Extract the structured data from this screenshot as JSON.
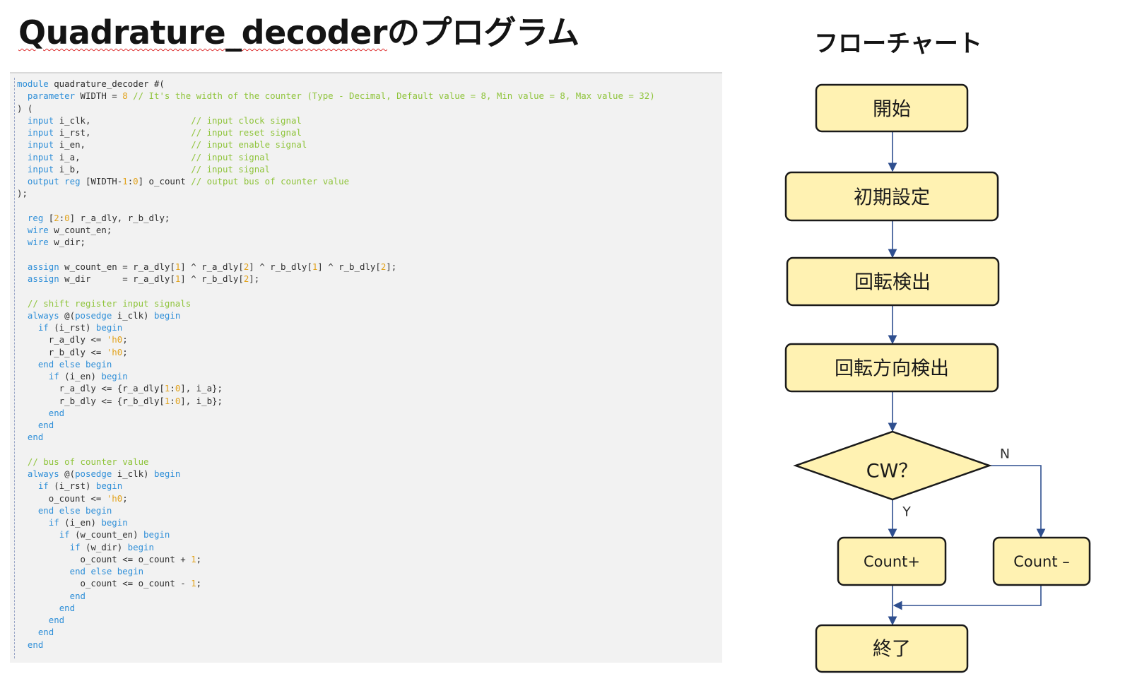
{
  "slide": {
    "title_main": "Quadrature_decoder",
    "title_suffix": "のプログラム"
  },
  "colors": {
    "keyword": "#2f8fd8",
    "comment": "#8fc43b",
    "number": "#e2a21a",
    "code_bg": "#f2f2f2",
    "node_fill": "#fff2b2",
    "node_stroke": "#1a1a1a",
    "edge": "#2f4f8f"
  },
  "code": {
    "language": "Verilog",
    "lines": [
      [
        [
          "kw",
          "module"
        ],
        [
          "id",
          " quadrature_decoder #("
        ]
      ],
      [
        [
          "id",
          "  "
        ],
        [
          "kw",
          "parameter"
        ],
        [
          "id",
          " WIDTH = "
        ],
        [
          "num",
          "8"
        ],
        [
          "id",
          " "
        ],
        [
          "cm",
          "// It's the width of the counter (Type - Decimal, Default value = 8, Min value = 8, Max value = 32)"
        ]
      ],
      [
        [
          "id",
          ") ("
        ]
      ],
      [
        [
          "id",
          "  "
        ],
        [
          "kw",
          "input"
        ],
        [
          "id",
          " i_clk,                   "
        ],
        [
          "cm",
          "// input clock signal"
        ]
      ],
      [
        [
          "id",
          "  "
        ],
        [
          "kw",
          "input"
        ],
        [
          "id",
          " i_rst,                   "
        ],
        [
          "cm",
          "// input reset signal"
        ]
      ],
      [
        [
          "id",
          "  "
        ],
        [
          "kw",
          "input"
        ],
        [
          "id",
          " i_en,                    "
        ],
        [
          "cm",
          "// input enable signal"
        ]
      ],
      [
        [
          "id",
          "  "
        ],
        [
          "kw",
          "input"
        ],
        [
          "id",
          " i_a,                     "
        ],
        [
          "cm",
          "// input signal"
        ]
      ],
      [
        [
          "id",
          "  "
        ],
        [
          "kw",
          "input"
        ],
        [
          "id",
          " i_b,                     "
        ],
        [
          "cm",
          "// input signal"
        ]
      ],
      [
        [
          "id",
          "  "
        ],
        [
          "kw",
          "output"
        ],
        [
          "id",
          " "
        ],
        [
          "kw",
          "reg"
        ],
        [
          "id",
          " [WIDTH-"
        ],
        [
          "num",
          "1"
        ],
        [
          "id",
          ":"
        ],
        [
          "num",
          "0"
        ],
        [
          "id",
          "] o_count "
        ],
        [
          "cm",
          "// output bus of counter value"
        ]
      ],
      [
        [
          "id",
          ");"
        ]
      ],
      [
        [
          "id",
          ""
        ]
      ],
      [
        [
          "id",
          "  "
        ],
        [
          "kw",
          "reg"
        ],
        [
          "id",
          " ["
        ],
        [
          "num",
          "2"
        ],
        [
          "id",
          ":"
        ],
        [
          "num",
          "0"
        ],
        [
          "id",
          "] r_a_dly, r_b_dly;"
        ]
      ],
      [
        [
          "id",
          "  "
        ],
        [
          "kw",
          "wire"
        ],
        [
          "id",
          " w_count_en;"
        ]
      ],
      [
        [
          "id",
          "  "
        ],
        [
          "kw",
          "wire"
        ],
        [
          "id",
          " w_dir;"
        ]
      ],
      [
        [
          "id",
          ""
        ]
      ],
      [
        [
          "id",
          "  "
        ],
        [
          "kw",
          "assign"
        ],
        [
          "id",
          " w_count_en = r_a_dly["
        ],
        [
          "num",
          "1"
        ],
        [
          "id",
          "] ^ r_a_dly["
        ],
        [
          "num",
          "2"
        ],
        [
          "id",
          "] ^ r_b_dly["
        ],
        [
          "num",
          "1"
        ],
        [
          "id",
          "] ^ r_b_dly["
        ],
        [
          "num",
          "2"
        ],
        [
          "id",
          "];"
        ]
      ],
      [
        [
          "id",
          "  "
        ],
        [
          "kw",
          "assign"
        ],
        [
          "id",
          " w_dir      = r_a_dly["
        ],
        [
          "num",
          "1"
        ],
        [
          "id",
          "] ^ r_b_dly["
        ],
        [
          "num",
          "2"
        ],
        [
          "id",
          "];"
        ]
      ],
      [
        [
          "id",
          ""
        ]
      ],
      [
        [
          "id",
          "  "
        ],
        [
          "cm",
          "// shift register input signals"
        ]
      ],
      [
        [
          "id",
          "  "
        ],
        [
          "kw",
          "always"
        ],
        [
          "id",
          " @("
        ],
        [
          "kw",
          "posedge"
        ],
        [
          "id",
          " i_clk) "
        ],
        [
          "kw",
          "begin"
        ]
      ],
      [
        [
          "id",
          "    "
        ],
        [
          "kw",
          "if"
        ],
        [
          "id",
          " (i_rst) "
        ],
        [
          "kw",
          "begin"
        ]
      ],
      [
        [
          "id",
          "      r_a_dly <= "
        ],
        [
          "str",
          "'h0"
        ],
        [
          "id",
          ";"
        ]
      ],
      [
        [
          "id",
          "      r_b_dly <= "
        ],
        [
          "str",
          "'h0"
        ],
        [
          "id",
          ";"
        ]
      ],
      [
        [
          "id",
          "    "
        ],
        [
          "kw",
          "end"
        ],
        [
          "id",
          " "
        ],
        [
          "kw",
          "else"
        ],
        [
          "id",
          " "
        ],
        [
          "kw",
          "begin"
        ]
      ],
      [
        [
          "id",
          "      "
        ],
        [
          "kw",
          "if"
        ],
        [
          "id",
          " (i_en) "
        ],
        [
          "kw",
          "begin"
        ]
      ],
      [
        [
          "id",
          "        r_a_dly <= {r_a_dly["
        ],
        [
          "num",
          "1"
        ],
        [
          "id",
          ":"
        ],
        [
          "num",
          "0"
        ],
        [
          "id",
          "], i_a};"
        ]
      ],
      [
        [
          "id",
          "        r_b_dly <= {r_b_dly["
        ],
        [
          "num",
          "1"
        ],
        [
          "id",
          ":"
        ],
        [
          "num",
          "0"
        ],
        [
          "id",
          "], i_b};"
        ]
      ],
      [
        [
          "id",
          "      "
        ],
        [
          "kw",
          "end"
        ]
      ],
      [
        [
          "id",
          "    "
        ],
        [
          "kw",
          "end"
        ]
      ],
      [
        [
          "id",
          "  "
        ],
        [
          "kw",
          "end"
        ]
      ],
      [
        [
          "id",
          ""
        ]
      ],
      [
        [
          "id",
          "  "
        ],
        [
          "cm",
          "// bus of counter value"
        ]
      ],
      [
        [
          "id",
          "  "
        ],
        [
          "kw",
          "always"
        ],
        [
          "id",
          " @("
        ],
        [
          "kw",
          "posedge"
        ],
        [
          "id",
          " i_clk) "
        ],
        [
          "kw",
          "begin"
        ]
      ],
      [
        [
          "id",
          "    "
        ],
        [
          "kw",
          "if"
        ],
        [
          "id",
          " (i_rst) "
        ],
        [
          "kw",
          "begin"
        ]
      ],
      [
        [
          "id",
          "      o_count <= "
        ],
        [
          "str",
          "'h0"
        ],
        [
          "id",
          ";"
        ]
      ],
      [
        [
          "id",
          "    "
        ],
        [
          "kw",
          "end"
        ],
        [
          "id",
          " "
        ],
        [
          "kw",
          "else"
        ],
        [
          "id",
          " "
        ],
        [
          "kw",
          "begin"
        ]
      ],
      [
        [
          "id",
          "      "
        ],
        [
          "kw",
          "if"
        ],
        [
          "id",
          " (i_en) "
        ],
        [
          "kw",
          "begin"
        ]
      ],
      [
        [
          "id",
          "        "
        ],
        [
          "kw",
          "if"
        ],
        [
          "id",
          " (w_count_en) "
        ],
        [
          "kw",
          "begin"
        ]
      ],
      [
        [
          "id",
          "          "
        ],
        [
          "kw",
          "if"
        ],
        [
          "id",
          " (w_dir) "
        ],
        [
          "kw",
          "begin"
        ]
      ],
      [
        [
          "id",
          "            o_count <= o_count + "
        ],
        [
          "num",
          "1"
        ],
        [
          "id",
          ";"
        ]
      ],
      [
        [
          "id",
          "          "
        ],
        [
          "kw",
          "end"
        ],
        [
          "id",
          " "
        ],
        [
          "kw",
          "else"
        ],
        [
          "id",
          " "
        ],
        [
          "kw",
          "begin"
        ]
      ],
      [
        [
          "id",
          "            o_count <= o_count - "
        ],
        [
          "num",
          "1"
        ],
        [
          "id",
          ";"
        ]
      ],
      [
        [
          "id",
          "          "
        ],
        [
          "kw",
          "end"
        ]
      ],
      [
        [
          "id",
          "        "
        ],
        [
          "kw",
          "end"
        ]
      ],
      [
        [
          "id",
          "      "
        ],
        [
          "kw",
          "end"
        ]
      ],
      [
        [
          "id",
          "    "
        ],
        [
          "kw",
          "end"
        ]
      ],
      [
        [
          "id",
          "  "
        ],
        [
          "kw",
          "end"
        ]
      ]
    ]
  },
  "flowchart": {
    "title": "フローチャート",
    "nodes": {
      "start": "開始",
      "init": "初期設定",
      "rotation_detect": "回転検出",
      "direction_detect": "回転方向検出",
      "decision": "CW？",
      "count_up": "Count+",
      "count_down": "Count –",
      "end": "終了"
    },
    "edges": {
      "yes": "Y",
      "no": "N"
    }
  }
}
